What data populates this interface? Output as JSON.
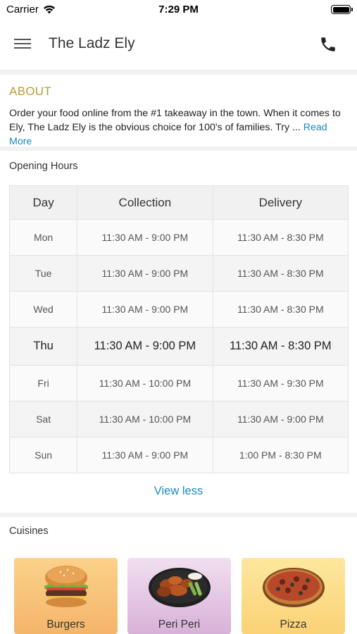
{
  "status": {
    "carrier": "Carrier",
    "time": "7:29 PM"
  },
  "nav": {
    "title": "The Ladz Ely"
  },
  "about": {
    "title": "ABOUT",
    "text": "Order your food online from the #1 takeaway in the town. When it comes to Ely, The Ladz Ely is the obvious choice for 100's of families. Try ... ",
    "read_more": "Read More"
  },
  "hours": {
    "title": "Opening Hours",
    "headers": [
      "Day",
      "Collection",
      "Delivery"
    ],
    "rows": [
      {
        "day": "Mon",
        "collection": "11:30 AM - 9:00 PM",
        "delivery": "11:30 AM - 8:30 PM"
      },
      {
        "day": "Tue",
        "collection": "11:30 AM - 9:00 PM",
        "delivery": "11:30 AM - 8:30 PM"
      },
      {
        "day": "Wed",
        "collection": "11:30 AM - 9:00 PM",
        "delivery": "11:30 AM - 8:30 PM"
      },
      {
        "day": "Thu",
        "collection": "11:30 AM - 9:00 PM",
        "delivery": "11:30 AM - 8:30 PM"
      },
      {
        "day": "Fri",
        "collection": "11:30 AM - 10:00 PM",
        "delivery": "11:30 AM - 9:30 PM"
      },
      {
        "day": "Sat",
        "collection": "11:30 AM - 10:00 PM",
        "delivery": "11:30 AM - 9:00 PM"
      },
      {
        "day": "Sun",
        "collection": "11:30 AM - 9:00 PM",
        "delivery": "1:00 PM - 8:30 PM"
      }
    ],
    "view_less": "View less"
  },
  "cuisines": {
    "title": "Cuisines",
    "items": [
      {
        "label": "Burgers",
        "icon": "burger-image"
      },
      {
        "label": "Peri Peri",
        "icon": "chicken-wings-image"
      },
      {
        "label": "Pizza",
        "icon": "pizza-image"
      }
    ]
  },
  "colors": {
    "accent_gold": "#b89b3a",
    "link_blue": "#1b8ac0"
  }
}
